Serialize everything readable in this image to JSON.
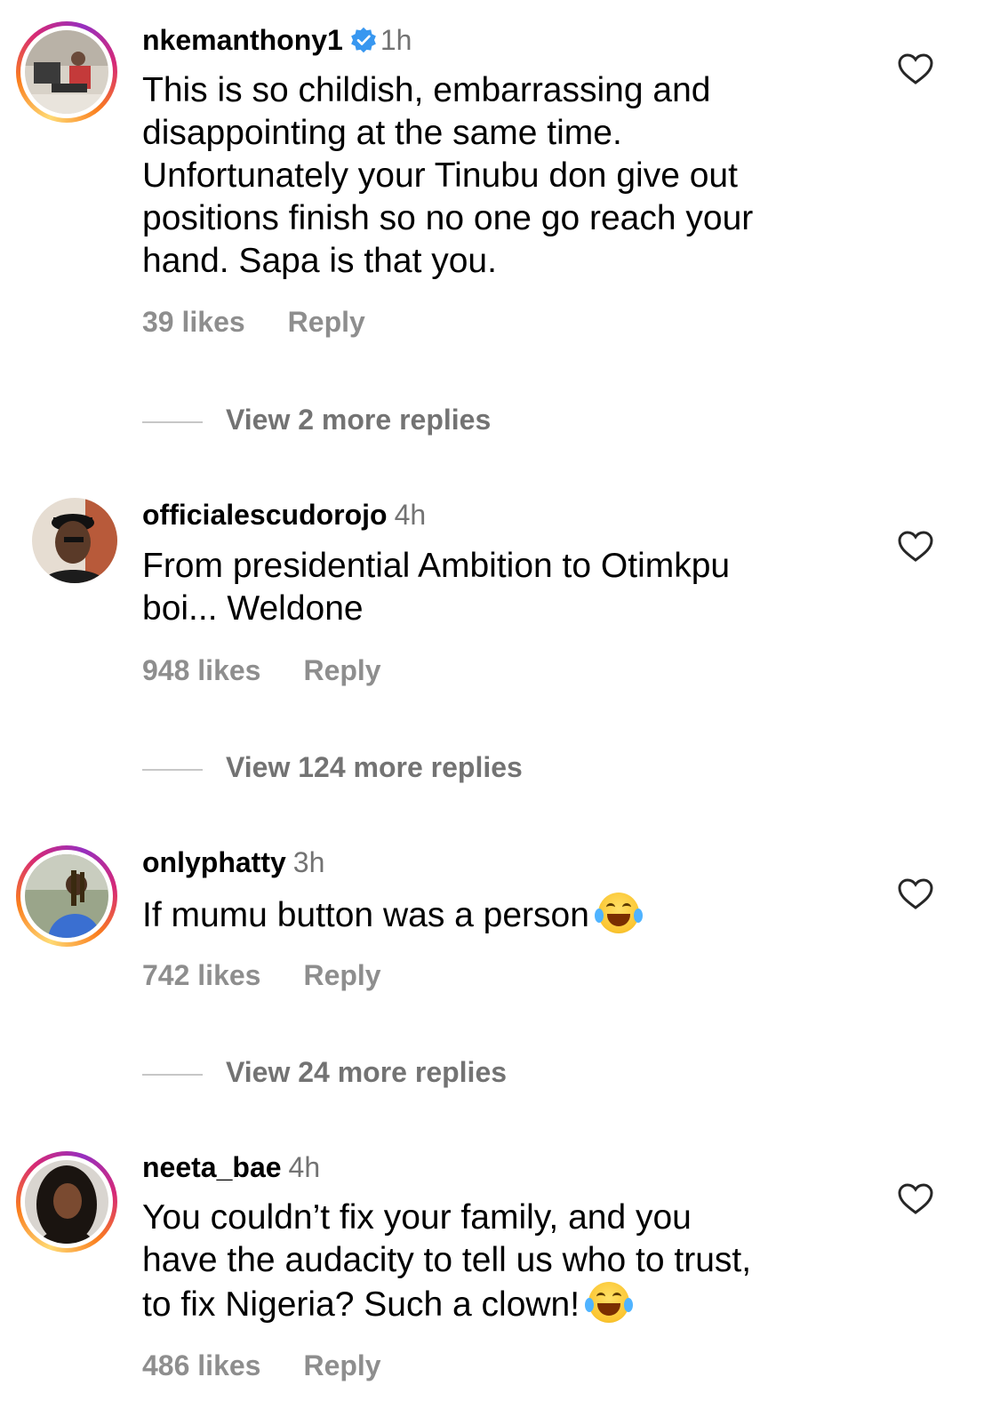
{
  "comments": [
    {
      "username": "nkemanthony1",
      "verified": true,
      "time": "1h",
      "has_story": true,
      "text_lines": [
        "This is so childish, embarrassing and",
        "disappointing at the same time.",
        "Unfortunately your Tinubu don give out",
        "positions finish so  no one go reach your",
        "hand. Sapa is that you."
      ],
      "likes": "39 likes",
      "reply": "Reply",
      "view_replies": "View 2 more replies"
    },
    {
      "username": "officialescudorojo",
      "verified": false,
      "time": "4h",
      "has_story": false,
      "text_lines": [
        "From presidential Ambition to Otimkpu",
        "boi... Weldone"
      ],
      "likes": "948 likes",
      "reply": "Reply",
      "view_replies": "View 124 more replies"
    },
    {
      "username": "onlyphatty",
      "verified": false,
      "time": "3h",
      "has_story": true,
      "text_lines": [
        "If mumu button was a person"
      ],
      "likes": "742 likes",
      "reply": "Reply",
      "view_replies": "View 24 more replies"
    },
    {
      "username": "neeta_bae",
      "verified": false,
      "time": "4h",
      "has_story": true,
      "text_lines": [
        "You couldn’t fix your family, and you",
        "have the audacity to tell us who to trust,",
        "to fix Nigeria? Such a clown!"
      ],
      "likes": "486 likes",
      "reply": "Reply"
    }
  ],
  "icons": {
    "verified": "verified-badge-icon",
    "like": "heart-outline-icon",
    "emoji": "face-with-tears-of-joy"
  },
  "colors": {
    "verified_blue": "#3897f0",
    "muted_text": "#737373",
    "story_ring": [
      "#feda75",
      "#fa7e1e",
      "#d62976",
      "#962fbf"
    ]
  }
}
